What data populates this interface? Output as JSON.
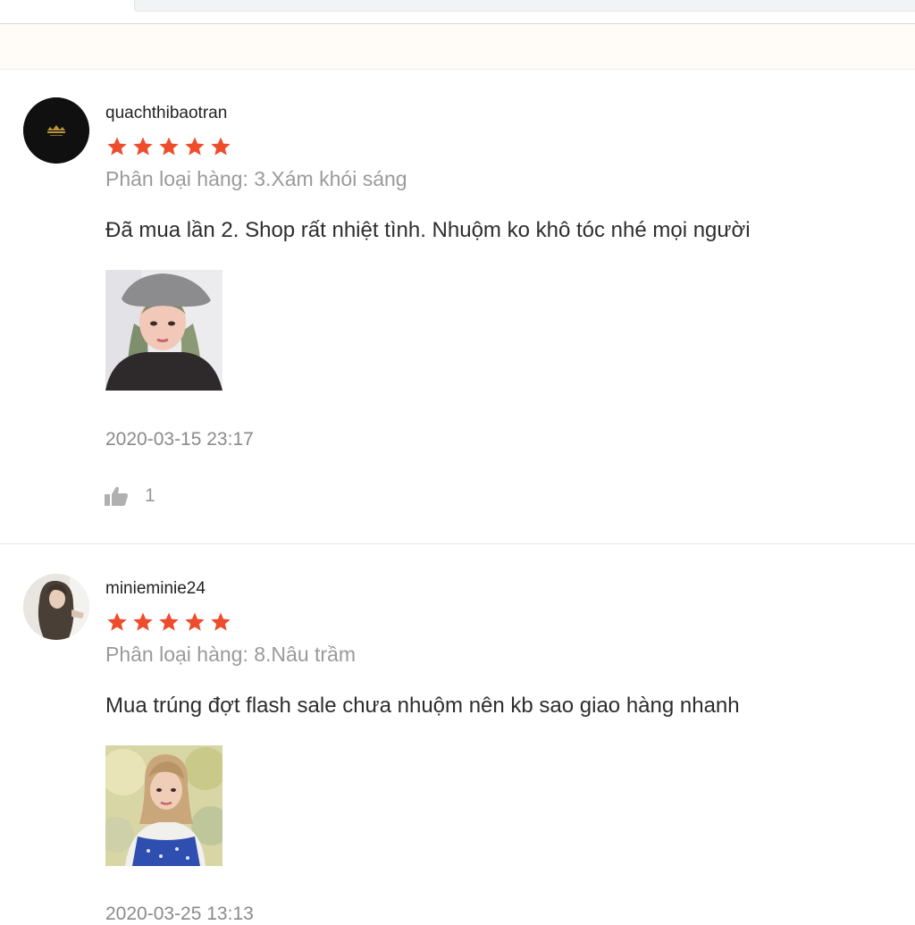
{
  "reviews": [
    {
      "username": "quachthibaotran",
      "rating": 5,
      "variant": "Phân loại hàng: 3.Xám khói sáng",
      "comment": "Đã mua lần 2. Shop rất nhiệt tình. Nhuộm ko khô tóc nhé mọi người",
      "date": "2020-03-15 23:17",
      "likes": "1",
      "avatar_icon": "dark-logo-avatar",
      "photo_icon": "customer-photo"
    },
    {
      "username": "minieminie24",
      "rating": 5,
      "variant": "Phân loại hàng: 8.Nâu trầm",
      "comment": "Mua trúng đợt flash sale chưa nhuộm nên kb sao giao hàng nhanh",
      "date": "2020-03-25 13:13",
      "avatar_icon": "user-photo-avatar",
      "photo_icon": "customer-photo"
    }
  ],
  "colors": {
    "star": "#ee4d2d",
    "variant_text": "#9a9a9a",
    "date_text": "#8a8a8a"
  }
}
